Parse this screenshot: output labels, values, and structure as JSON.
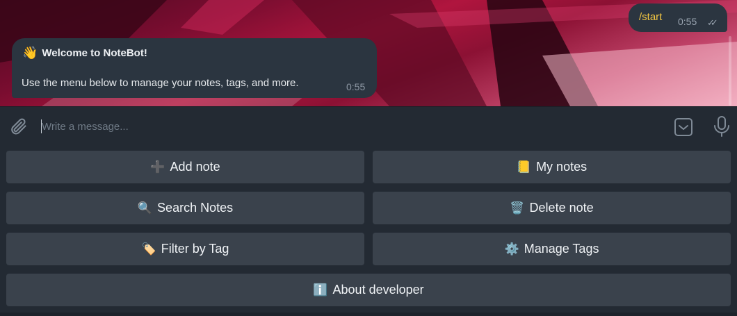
{
  "messages": {
    "outgoing": {
      "text": "/start",
      "time": "0:55",
      "status_icon": "double-check-icon"
    },
    "incoming": {
      "title_emoji": "👋",
      "title": "Welcome to NoteBot!",
      "body": "Use the menu below to manage your notes, tags, and more.",
      "time": "0:55"
    }
  },
  "composer": {
    "placeholder": "Write a message...",
    "value": "",
    "icons": {
      "attach": "paperclip-icon",
      "keyboard": "keyboard-toggle-icon",
      "mic": "microphone-icon"
    }
  },
  "keyboard": {
    "buttons": [
      {
        "emoji": "➕",
        "label": "Add note"
      },
      {
        "emoji": "📒",
        "label": "My notes"
      },
      {
        "emoji": "🔍",
        "label": "Search Notes"
      },
      {
        "emoji": "🗑️",
        "label": "Delete note"
      },
      {
        "emoji": "🏷️",
        "label": "Filter by Tag"
      },
      {
        "emoji": "⚙️",
        "label": "Manage Tags"
      },
      {
        "emoji": "ℹ️",
        "label": "About developer"
      }
    ]
  },
  "colors": {
    "bubble": "#2b3540",
    "button": "#3a424c",
    "background": "#232a33",
    "command_text": "#f5c842"
  }
}
